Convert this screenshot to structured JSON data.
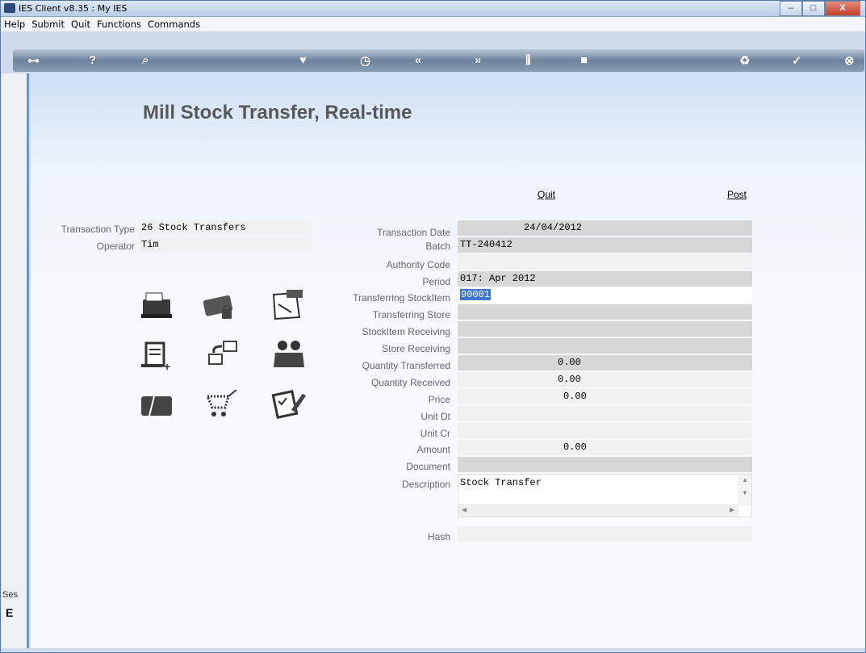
{
  "window": {
    "title": "IES Client v8.35 : My IES",
    "minimize": "–",
    "maximize": "□",
    "close": "X"
  },
  "menu": [
    "Help",
    "Submit",
    "Quit",
    "Functions",
    "Commands"
  ],
  "toolbar": {
    "icons": [
      "key-icon",
      "help-icon",
      "search-icon",
      "heart-icon",
      "clock-icon",
      "rewind-icon",
      "forward-icon",
      "tools-icon",
      "stop-icon",
      "recycle-icon",
      "check-icon",
      "close-icon"
    ],
    "glyphs": [
      "⊶",
      "?",
      "⌕",
      "♥",
      "◷",
      "«",
      "»",
      "⫼",
      "■",
      "♻",
      "✓",
      "⊗"
    ]
  },
  "page": {
    "title": "Mill Stock Transfer, Real-time"
  },
  "actions": {
    "quit": "Quit",
    "post": "Post"
  },
  "left_fields": {
    "transaction_type_label": "Transaction Type",
    "transaction_type_value": "26 Stock Transfers",
    "operator_label": "Operator",
    "operator_value": "Tim"
  },
  "form": {
    "transaction_date_label": "Transaction Date",
    "transaction_date": "24/04/2012",
    "batch_label": "Batch",
    "batch": "TT-240412",
    "authority_code_label": "Authority Code",
    "authority_code": "",
    "period_label": "Period",
    "period": "017: Apr 2012",
    "transferring_stockitem_label": "Transferring StockItem",
    "transferring_stockitem": "90001",
    "transferring_store_label": "Transferring Store",
    "transferring_store": "",
    "stockitem_receiving_label": "StockItem Receiving",
    "stockitem_receiving": "",
    "store_receiving_label": "Store Receiving",
    "store_receiving": "",
    "quantity_transferred_label": "Quantity Transferred",
    "quantity_transferred": "0.00",
    "quantity_received_label": "Quantity Received",
    "quantity_received": "0.00",
    "price_label": "Price",
    "price": "0.00",
    "unit_dt_label": "Unit Dt",
    "unit_dt": "",
    "unit_cr_label": "Unit Cr",
    "unit_cr": "",
    "amount_label": "Amount",
    "amount": "0.00",
    "document_label": "Document",
    "document": "",
    "description_label": "Description",
    "description": "Stock Transfer",
    "hash_label": "Hash",
    "hash": ""
  },
  "side": {
    "ses": "Ses",
    "glyph": "E"
  }
}
